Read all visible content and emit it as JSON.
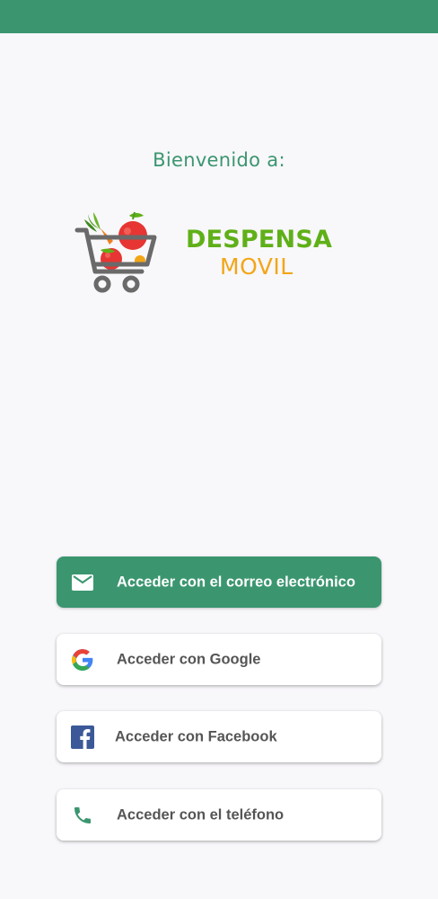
{
  "welcome": {
    "text": "Bienvenido a:"
  },
  "brand": {
    "line1": "DESPENSA",
    "line2": "MOVIL",
    "logo_icon": "shopping-cart-with-vegetables-icon",
    "colors": {
      "green": "#5fb018",
      "orange": "#f2a617"
    }
  },
  "auth": {
    "buttons": [
      {
        "id": "email",
        "label": "Acceder con el correo electrónico",
        "icon": "mail-icon"
      },
      {
        "id": "google",
        "label": "Acceder con Google",
        "icon": "google-icon"
      },
      {
        "id": "facebook",
        "label": "Acceder con Facebook",
        "icon": "facebook-icon"
      },
      {
        "id": "phone",
        "label": "Acceder con el teléfono",
        "icon": "phone-icon"
      }
    ]
  },
  "theme": {
    "primary": "#3b9670",
    "background": "#f8f7fa"
  }
}
